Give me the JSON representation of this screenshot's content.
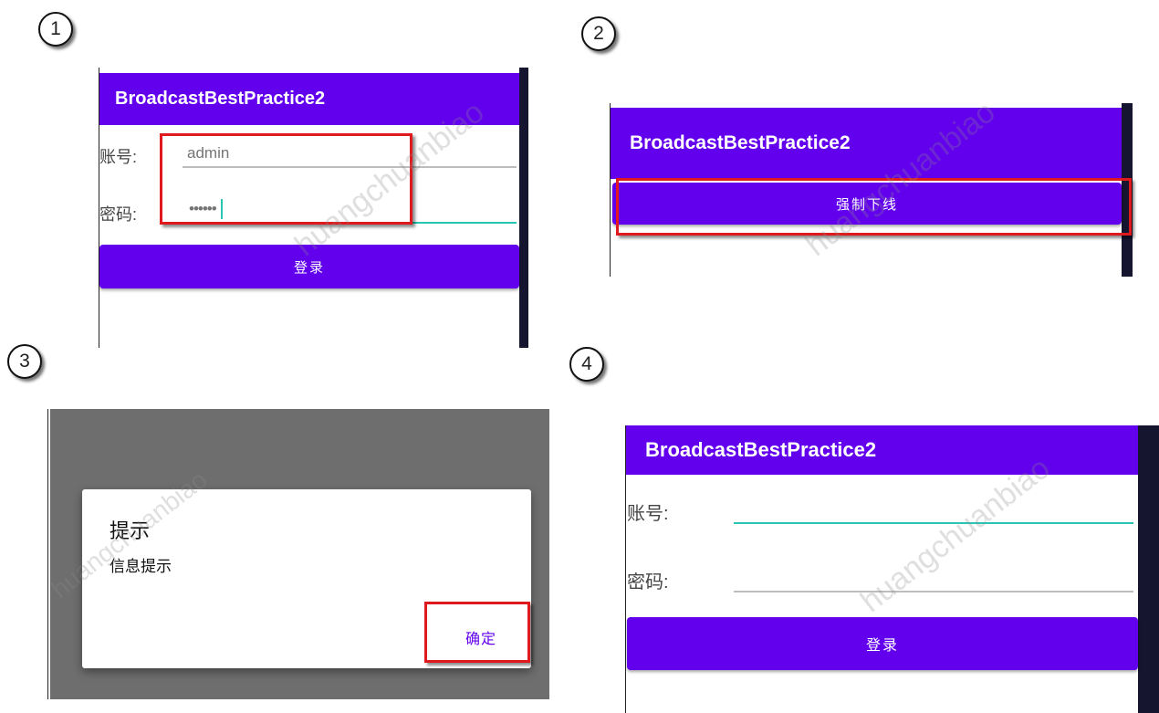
{
  "steps": [
    "1",
    "2",
    "3",
    "4"
  ],
  "app_title": "BroadcastBestPractice2",
  "login": {
    "account_label": "账号:",
    "password_label": "密码:",
    "account_value": "admin",
    "password_value": "••••••",
    "login_button": "登录"
  },
  "force_offline_button": "强制下线",
  "dialog": {
    "title": "提示",
    "message": "信息提示",
    "confirm_button": "确定"
  },
  "watermark": "huangchuanbiao",
  "colors": {
    "primary": "#6200ee",
    "highlight_box": "#e0191e",
    "focused_underline": "#26c6b2",
    "dim_overlay": "#6e6e6e"
  }
}
